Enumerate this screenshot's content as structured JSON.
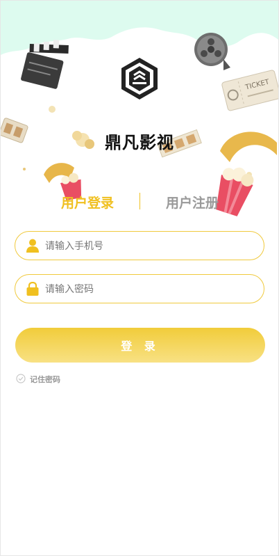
{
  "app": {
    "title": "鼎凡影视"
  },
  "tabs": {
    "login": "用户登录",
    "register": "用户注册",
    "active": "login"
  },
  "form": {
    "phone": {
      "placeholder": "请输入手机号",
      "value": ""
    },
    "password": {
      "placeholder": "请输入密码",
      "value": ""
    },
    "submit_label": "登 录",
    "remember_label": "记住密码",
    "remember_checked": false
  },
  "decor": {
    "ticket_label": "TICKET",
    "icons": [
      "clapperboard-icon",
      "film-reel-icon",
      "ticket-icon",
      "popcorn-bucket-icon",
      "popcorn-icon",
      "film-strip-icon"
    ]
  },
  "colors": {
    "accent": "#f0c020",
    "header_bg": "#ddfbef",
    "inactive_tab": "#999999"
  }
}
